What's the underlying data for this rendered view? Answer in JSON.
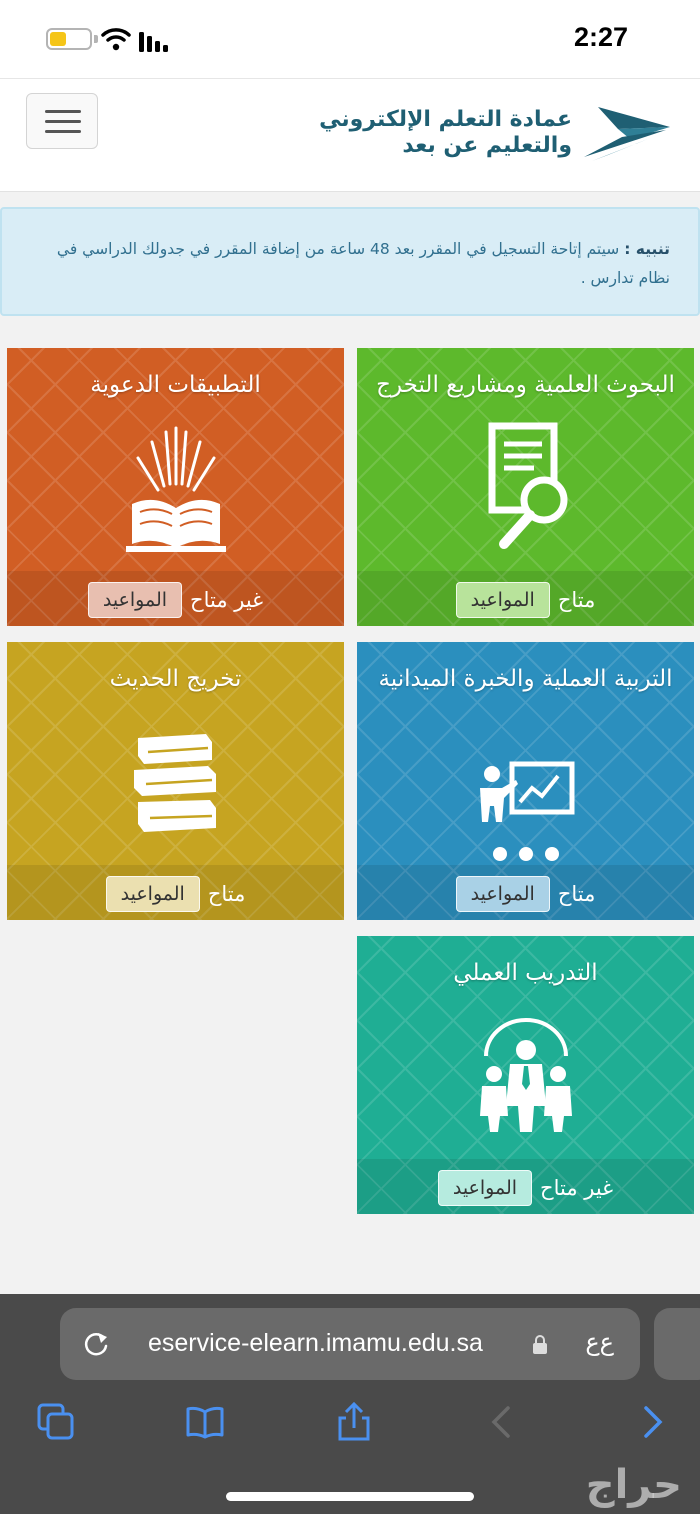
{
  "status_bar": {
    "time": "2:27"
  },
  "header": {
    "logo_line1": "عمادة التعلم الإلكتروني",
    "logo_line2": "والتعليم عن بعد",
    "logo_icon": "paper-plane-icon",
    "menu_icon": "hamburger-icon"
  },
  "alert": {
    "label": "تنبيه :",
    "message": "سيتم إتاحة التسجيل في المقرر بعد 48 ساعة من إضافة المقرر في جدولك الدراسي في نظام تدارس ."
  },
  "tiles": [
    {
      "title": "البحوث العلمية ومشاريع التخرج",
      "status": "متاح",
      "button": "المواعيد",
      "icon": "document-search-icon",
      "color": "#5db92c"
    },
    {
      "title": "التطبيقات الدعوية",
      "status": "غير متاح",
      "button": "المواعيد",
      "icon": "open-book-icon",
      "color": "#d15e24"
    },
    {
      "title": "التربية العملية والخبرة الميدانية",
      "status": "متاح",
      "button": "المواعيد",
      "icon": "presenter-board-icon",
      "color": "#2b8fbe"
    },
    {
      "title": "تخريج الحديث",
      "status": "متاح",
      "button": "المواعيد",
      "icon": "book-stack-icon",
      "color": "#c6a421"
    },
    {
      "title": "التدريب العملي",
      "status": "غير متاح",
      "button": "المواعيد",
      "icon": "team-icon",
      "color": "#1fae94"
    }
  ],
  "browser": {
    "url": "eservice-elearn.imamu.edu.sa",
    "text_size_button": "ﻉﻉ",
    "toolbar_icons": [
      "tabs-icon",
      "bookmarks-icon",
      "share-icon",
      "back-icon",
      "forward-icon"
    ]
  },
  "watermark": "حراج"
}
